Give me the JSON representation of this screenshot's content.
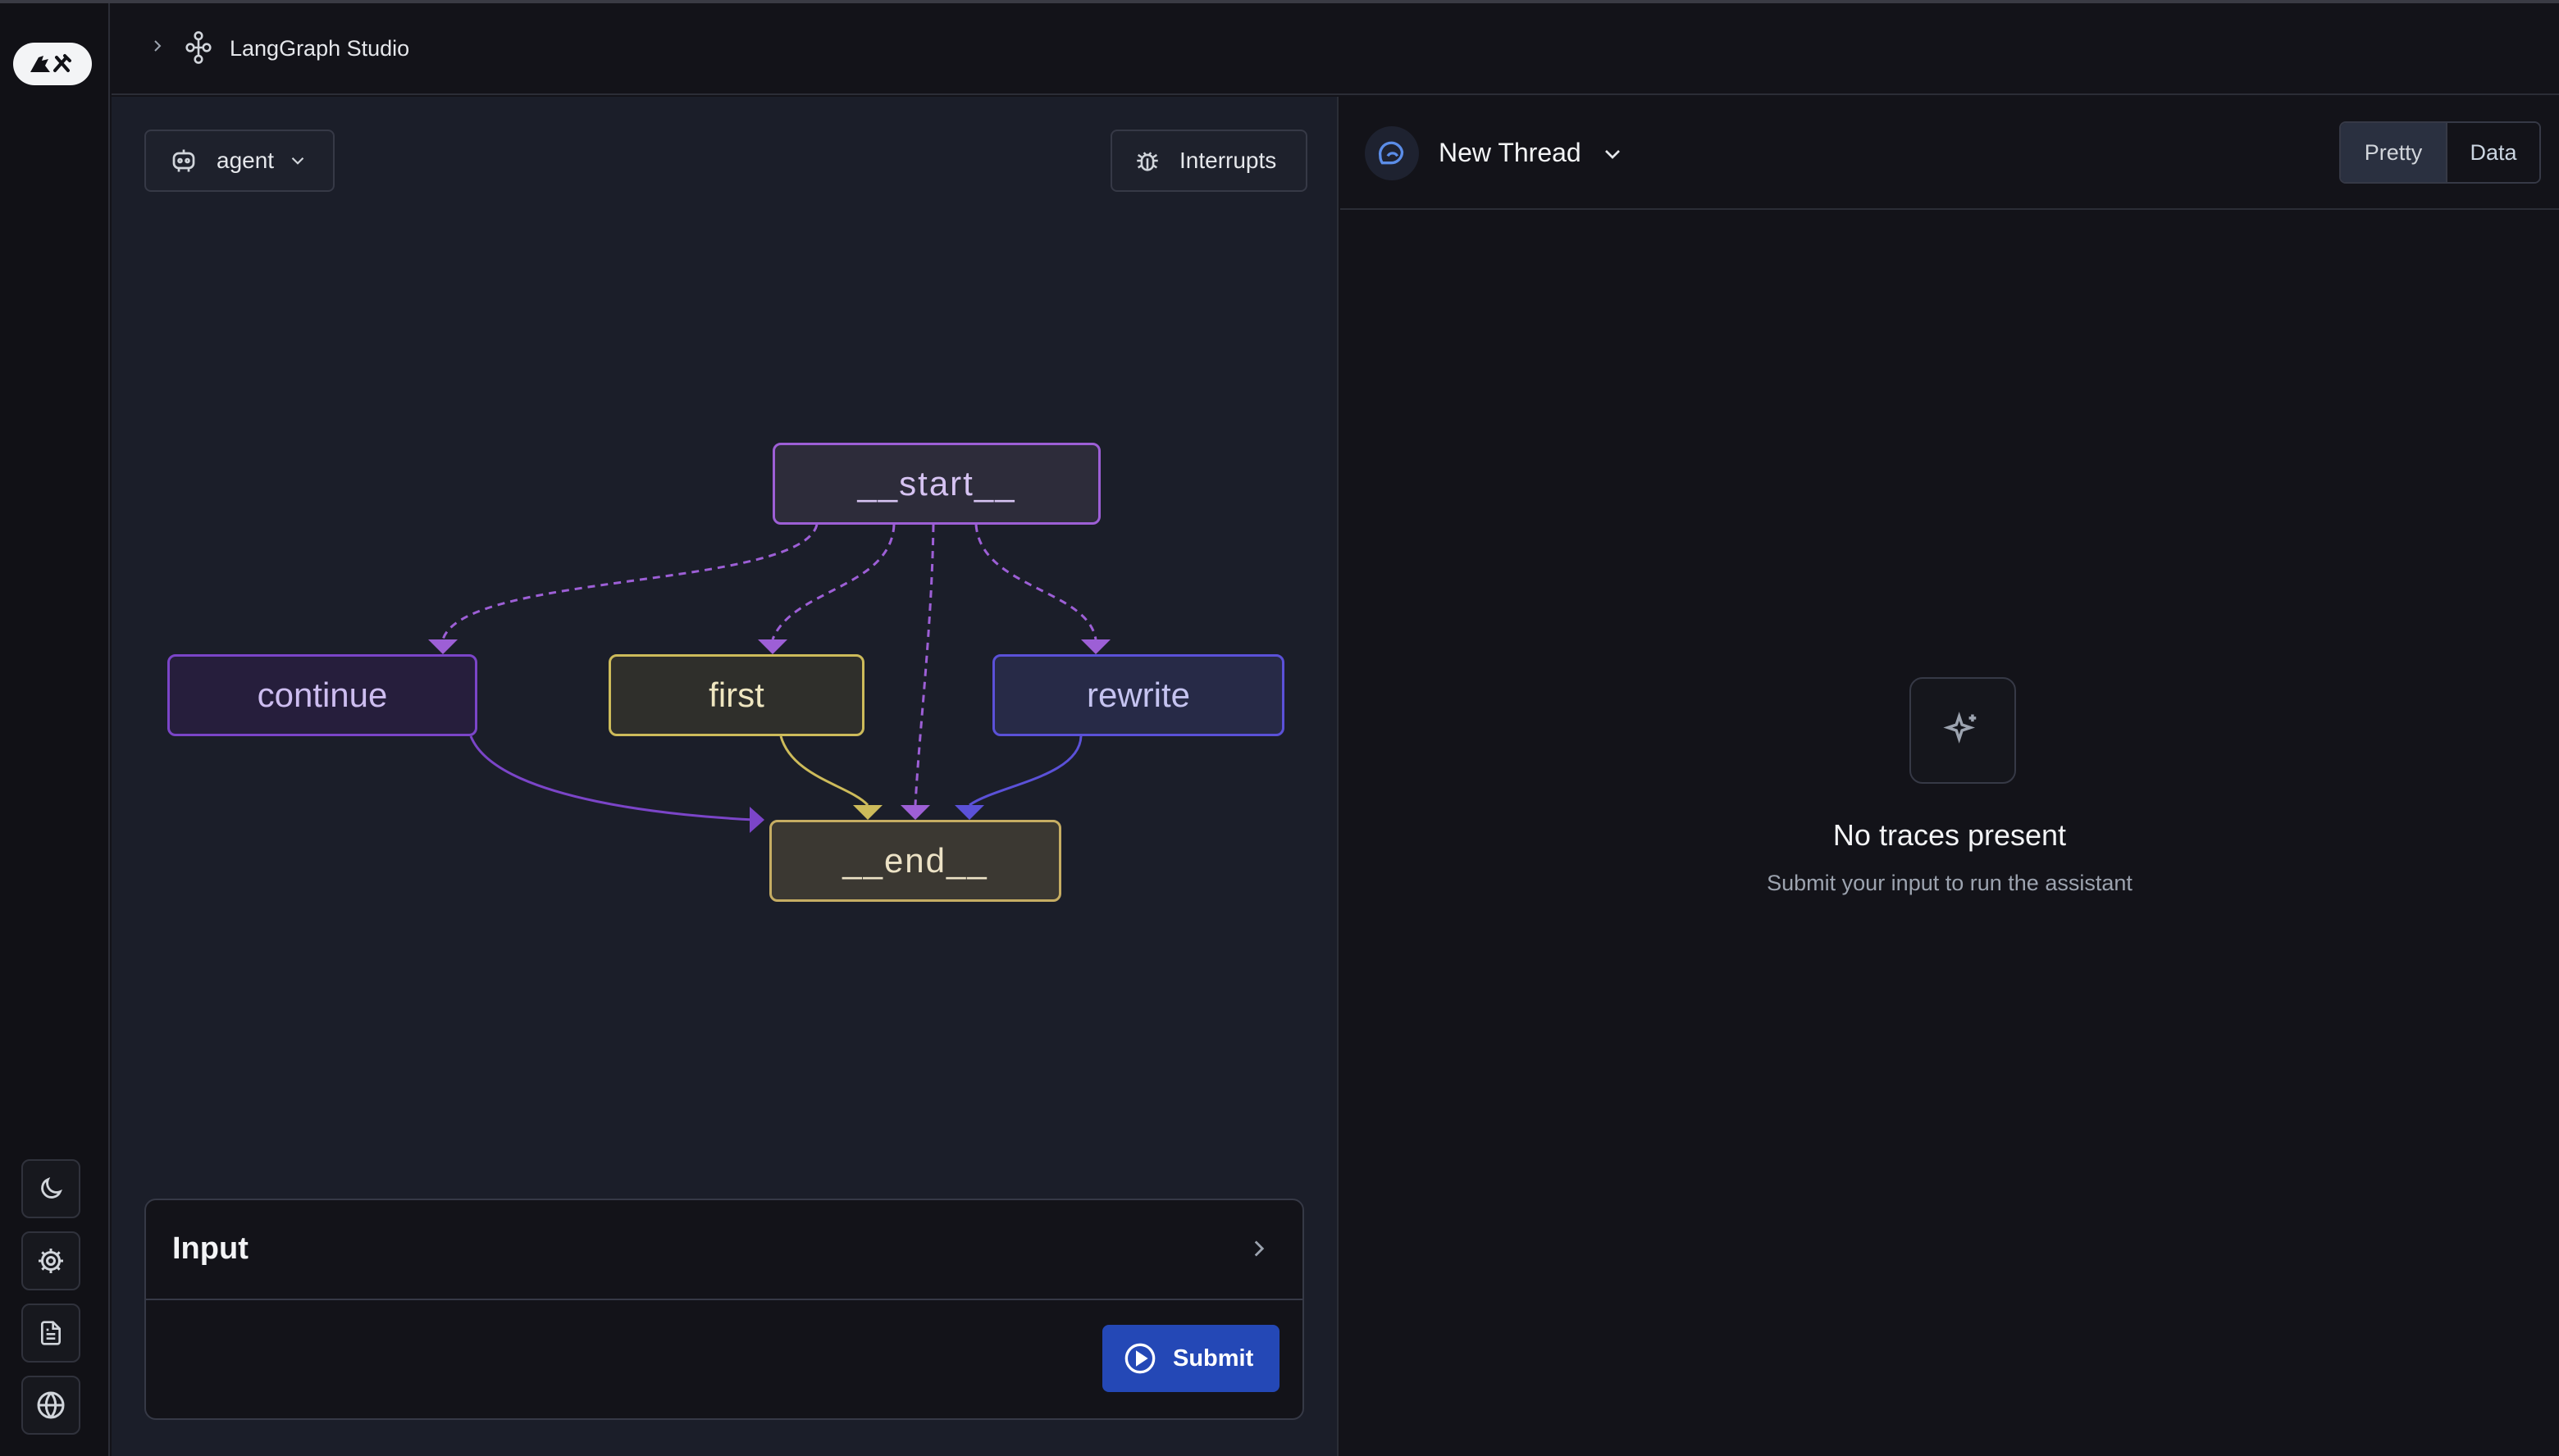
{
  "header": {
    "title": "LangGraph Studio"
  },
  "graph_selector": {
    "label": "agent"
  },
  "toolbar": {
    "interrupts_label": "Interrupts"
  },
  "graph": {
    "nodes": {
      "start": "__start__",
      "continue": "continue",
      "first": "first",
      "rewrite": "rewrite",
      "end": "__end__"
    },
    "colors": {
      "start": "#9d5fd6",
      "continue": "#7b45c8",
      "first": "#cdbb5a",
      "rewrite": "#5b51d8",
      "end": "#c6ad63"
    }
  },
  "input": {
    "title": "Input",
    "submit_label": "Submit"
  },
  "thread": {
    "title": "New Thread"
  },
  "view_toggle": {
    "pretty": "Pretty",
    "data": "Data",
    "active": "Pretty"
  },
  "empty_state": {
    "title": "No traces present",
    "subtitle": "Submit your input to run the assistant"
  },
  "icons": {
    "logo": "langgraph-logo-icon",
    "theme": "moon-icon",
    "settings": "gear-icon",
    "docs": "document-icon",
    "web": "globe-icon"
  }
}
